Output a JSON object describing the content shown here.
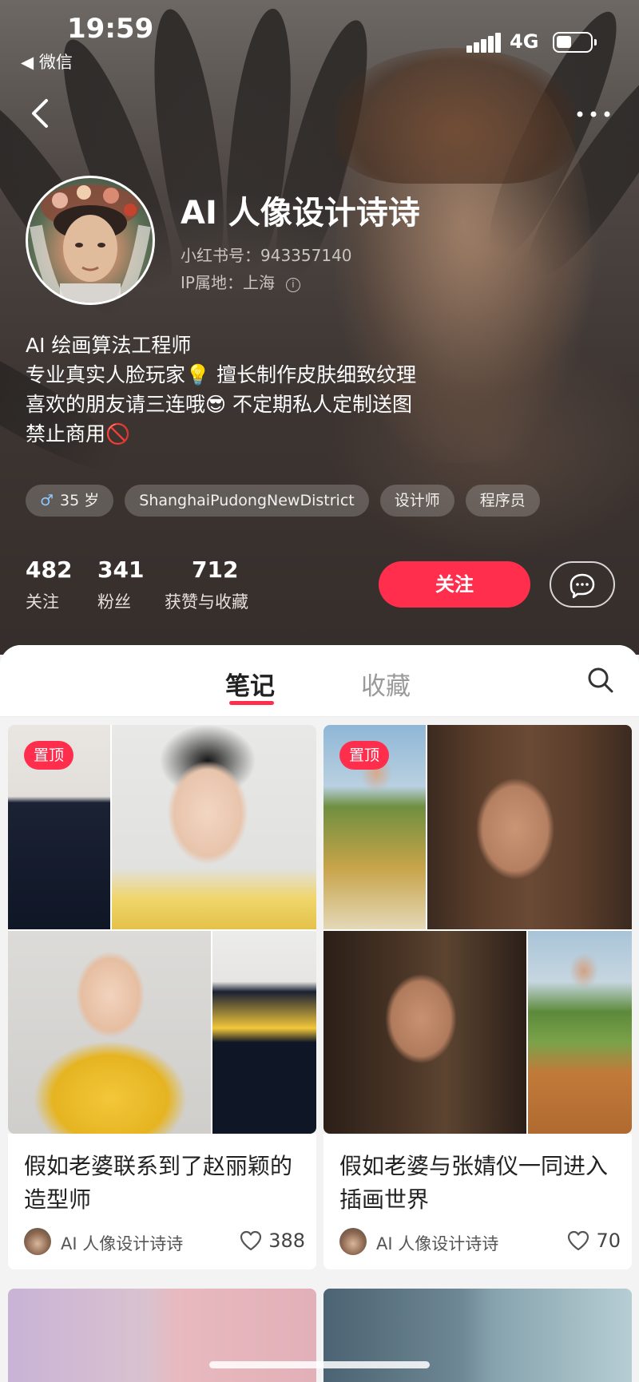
{
  "status_bar": {
    "time": "19:59",
    "back_app": "◀ 微信",
    "network": "4G",
    "battery_percent": 45
  },
  "nav": {
    "back_icon": "chevron-left-icon",
    "more_icon": "more-dots-icon"
  },
  "profile": {
    "name": "AI 人像设计诗诗",
    "red_id": "小红书号：943357140",
    "ip_location": "IP属地：上海",
    "info_icon": "ⓘ",
    "bio": [
      "AI 绘画算法工程师",
      "专业真实人脸玩家💡 擅长制作皮肤细致纹理",
      "喜欢的朋友请三连哦😎 不定期私人定制送图",
      "禁止商用🚫"
    ],
    "tags": [
      {
        "icon": "♂",
        "label": "35 岁"
      },
      {
        "label": "ShanghaiPudongNewDistrict"
      },
      {
        "label": "设计师"
      },
      {
        "label": "程序员"
      }
    ],
    "stats": [
      {
        "value": "482",
        "label": "关注"
      },
      {
        "value": "341",
        "label": "粉丝"
      },
      {
        "value": "712",
        "label": "获赞与收藏"
      }
    ],
    "follow_label": "关注",
    "chat_icon": "chat-bubble-icon"
  },
  "tabs": {
    "notes": "笔记",
    "collections": "收藏",
    "search_icon": "search-icon",
    "accent": "#ff2e4d"
  },
  "posts": [
    {
      "pinned_label": "置顶",
      "title": "假如老婆联系到了赵丽颖的造型师",
      "author": "AI 人像设计诗诗",
      "likes": "388"
    },
    {
      "pinned_label": "置顶",
      "title": "假如老婆与张婧仪一同进入插画世界",
      "author": "AI 人像设计诗诗",
      "likes": "70"
    }
  ]
}
